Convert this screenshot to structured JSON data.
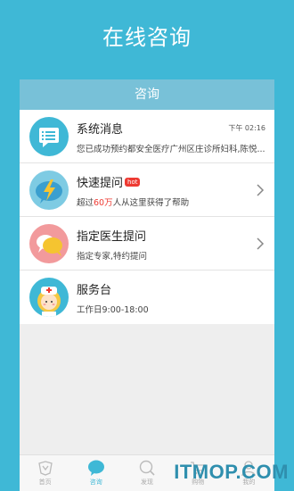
{
  "title": "在线咨询",
  "panel": {
    "header": "咨询"
  },
  "items": [
    {
      "title": "系统消息",
      "time": "下午 02:16",
      "subtitle": "您已成功预约都安全医疗广州区庄诊所妇科,陈悦..."
    },
    {
      "title": "快速提问",
      "badge": "hot",
      "subtitle_pre": "超过",
      "subtitle_accent": "60万",
      "subtitle_post": "人从这里获得了帮助"
    },
    {
      "title": "指定医生提问",
      "subtitle": "指定专家,特约提问"
    },
    {
      "title": "服务台",
      "subtitle": "工作日9:00-18:00"
    }
  ],
  "tabs": [
    {
      "label": "首页",
      "icon": "home-icon"
    },
    {
      "label": "咨询",
      "icon": "chat-bubble-icon",
      "active": true
    },
    {
      "label": "发现",
      "icon": "discover-search-icon"
    },
    {
      "label": "购物",
      "icon": "cart-icon"
    },
    {
      "label": "我的",
      "icon": "user-icon"
    }
  ],
  "watermark": "ITMOP.COM",
  "colors": {
    "primary": "#3fb8d6",
    "header": "#78c1d8",
    "accent": "#ee3a32"
  }
}
